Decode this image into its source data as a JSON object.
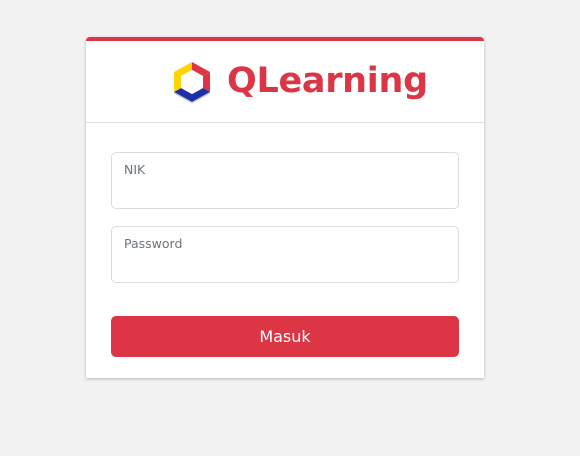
{
  "brand": {
    "name": "QLearning",
    "logo_icon": "hexagon-logo-icon",
    "color": "#dc3545"
  },
  "form": {
    "nik": {
      "label": "NIK",
      "value": "",
      "placeholder": ""
    },
    "password": {
      "label": "Password",
      "value": "",
      "placeholder": ""
    },
    "submit_label": "Masuk"
  },
  "colors": {
    "accent": "#dc3545",
    "page_background": "#f2f2f2",
    "logo_yellow": "#ffd400",
    "logo_blue": "#1f2fa8",
    "logo_red": "#dc3545"
  }
}
